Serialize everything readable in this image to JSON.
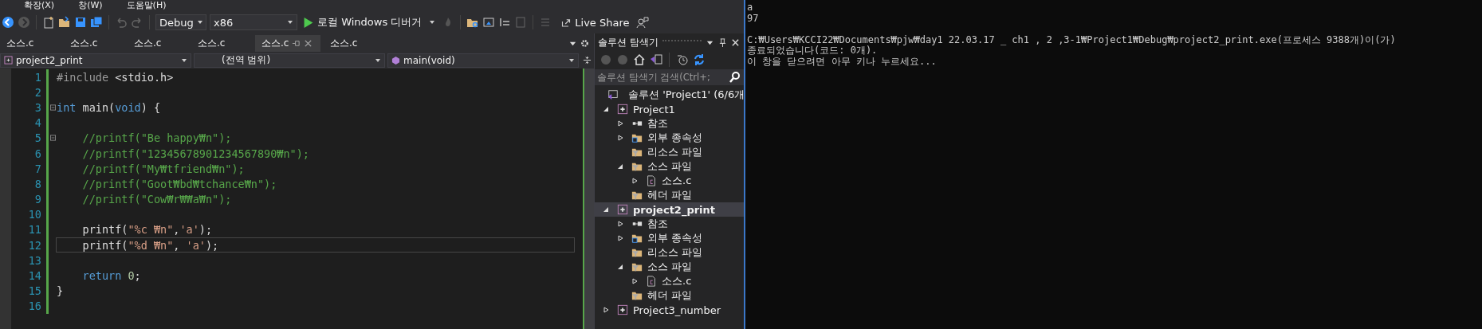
{
  "menu": [
    "확장(X)",
    "창(W)",
    "도움말(H)"
  ],
  "toolbar": {
    "configuration": "Debug",
    "platform": "x86",
    "run_button": "로컬 Windows 디버거",
    "live_share": "Live Share"
  },
  "tabs": [
    {
      "label": "소스.c",
      "selected": false
    },
    {
      "label": "소스.c",
      "selected": false
    },
    {
      "label": "소스.c",
      "selected": false
    },
    {
      "label": "소스.c",
      "selected": false
    },
    {
      "label": "소스.c",
      "selected": true
    },
    {
      "label": "소스.c",
      "selected": false
    }
  ],
  "navigation_bar": {
    "project": "project2_print",
    "scope": "(전역 범위)",
    "member": "main(void)"
  },
  "editor": {
    "lines": [
      {
        "number": "1",
        "current": false,
        "fold": false,
        "tokens": [
          {
            "kind": "pre",
            "text": "#include"
          },
          {
            "kind": "plain",
            "text": " <stdio.h>"
          }
        ]
      },
      {
        "number": "2",
        "current": false,
        "fold": false
      },
      {
        "number": "3",
        "current": false,
        "fold": true,
        "tokens": [
          {
            "kind": "kw",
            "text": "int"
          },
          {
            "kind": "plain",
            "text": " main("
          },
          {
            "kind": "kw",
            "text": "void"
          },
          {
            "kind": "plain",
            "text": ") {"
          }
        ]
      },
      {
        "number": "4",
        "current": false,
        "fold": false
      },
      {
        "number": "5",
        "current": false,
        "fold": true,
        "tokens": [
          {
            "kind": "com",
            "text": "    //printf(\"Be happy₩n\");"
          }
        ]
      },
      {
        "number": "6",
        "current": false,
        "fold": false,
        "tokens": [
          {
            "kind": "com",
            "text": "    //printf(\"12345678901234567890₩n\");"
          }
        ]
      },
      {
        "number": "7",
        "current": false,
        "fold": false,
        "tokens": [
          {
            "kind": "com",
            "text": "    //printf(\"My₩tfriend₩n\");"
          }
        ]
      },
      {
        "number": "8",
        "current": false,
        "fold": false,
        "tokens": [
          {
            "kind": "com",
            "text": "    //printf(\"Goot₩bd₩tchance₩n\");"
          }
        ]
      },
      {
        "number": "9",
        "current": false,
        "fold": false,
        "tokens": [
          {
            "kind": "com",
            "text": "    //printf(\"Cow₩r₩₩a₩n\");"
          }
        ]
      },
      {
        "number": "10",
        "current": false,
        "fold": false
      },
      {
        "number": "11",
        "current": false,
        "fold": false,
        "tokens": [
          {
            "kind": "plain",
            "text": "    printf("
          },
          {
            "kind": "str",
            "text": "\"%c ₩n\""
          },
          {
            "kind": "plain",
            "text": ","
          },
          {
            "kind": "str",
            "text": "'a'"
          },
          {
            "kind": "plain",
            "text": ");"
          }
        ]
      },
      {
        "number": "12",
        "current": true,
        "fold": false,
        "tokens": [
          {
            "kind": "plain",
            "text": "    printf("
          },
          {
            "kind": "str",
            "text": "\"%d ₩n\""
          },
          {
            "kind": "plain",
            "text": ", "
          },
          {
            "kind": "str",
            "text": "'a'"
          },
          {
            "kind": "plain",
            "text": ");"
          }
        ]
      },
      {
        "number": "13",
        "current": false,
        "fold": false
      },
      {
        "number": "14",
        "current": false,
        "fold": false,
        "tokens": [
          {
            "kind": "kw",
            "text": "    return"
          },
          {
            "kind": "num",
            "text": " 0"
          },
          {
            "kind": "plain",
            "text": ";"
          }
        ]
      },
      {
        "number": "15",
        "current": false,
        "fold": false,
        "tokens": [
          {
            "kind": "plain",
            "text": "}"
          }
        ]
      },
      {
        "number": "16",
        "current": false,
        "fold": false
      }
    ]
  },
  "explorer": {
    "title": "솔루션 탐색기",
    "search": {
      "placeholder": "솔루션 탐색기 검색(Ctrl+;"
    },
    "solution": "솔루션 'Project1' (6/6개",
    "tree": [
      {
        "label": "Project1",
        "kind": "project",
        "expanded": true,
        "selected": false,
        "children": [
          {
            "label": "참조",
            "kind": "references",
            "expanded": false,
            "selected": false
          },
          {
            "label": "외부 종속성",
            "kind": "external",
            "expanded": false,
            "selected": false
          },
          {
            "label": "리소스 파일",
            "kind": "filter",
            "selected": false
          },
          {
            "label": "소스 파일",
            "kind": "filter-open",
            "expanded": true,
            "selected": false,
            "children": [
              {
                "label": "소스.c",
                "kind": "file",
                "expanded": false,
                "selected": false
              }
            ]
          },
          {
            "label": "헤더 파일",
            "kind": "filter",
            "selected": false
          }
        ]
      },
      {
        "label": "project2_print",
        "kind": "project",
        "expanded": true,
        "selected": true,
        "children": [
          {
            "label": "참조",
            "kind": "references",
            "expanded": false,
            "selected": false
          },
          {
            "label": "외부 종속성",
            "kind": "external",
            "expanded": false,
            "selected": false
          },
          {
            "label": "리소스 파일",
            "kind": "filter",
            "selected": false
          },
          {
            "label": "소스 파일",
            "kind": "filter-open",
            "expanded": true,
            "selected": false,
            "children": [
              {
                "label": "소스.c",
                "kind": "file",
                "expanded": false,
                "selected": false
              }
            ]
          },
          {
            "label": "헤더 파일",
            "kind": "filter",
            "selected": false
          }
        ]
      },
      {
        "label": "Project3_number",
        "kind": "project",
        "expanded": false,
        "selected": false
      }
    ]
  },
  "console": {
    "output": [
      "a",
      "97"
    ],
    "exit_message": [
      "C:₩Users₩KCCI22₩Documents₩pjw₩day1 22.03.17 _ ch1 , 2 ,3-1₩Project1₩Debug₩project2_print.exe(프로세스 9388개)이(가)",
      "종료되었습니다(코드: 0개).",
      "이 창을 닫으려면 아무 키나 누르세요..."
    ]
  }
}
